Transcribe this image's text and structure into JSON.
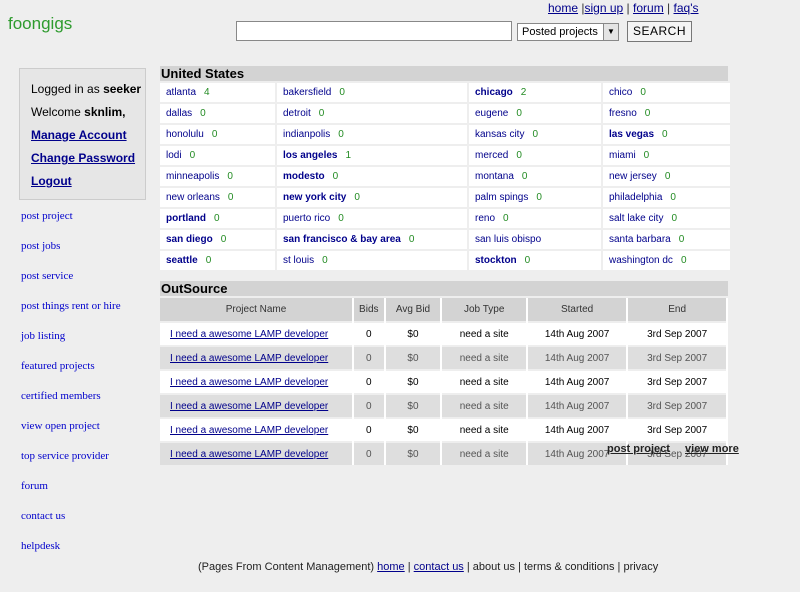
{
  "brand": "foongigs",
  "top_links": [
    {
      "label": "home"
    },
    {
      "label": "sign up"
    },
    {
      "label": "forum"
    },
    {
      "label": "faq's"
    }
  ],
  "search": {
    "value": "",
    "select_value": "Posted projects",
    "button_label": "SEARCH"
  },
  "user_panel": {
    "logged_in_text": "Logged in as ",
    "username": "seeker",
    "welcome_text": "Welcome ",
    "display_name": "sknlim,",
    "manage_account": "Manage Account",
    "change_password": "Change Password",
    "logout": "Logout"
  },
  "left_nav": [
    "post project",
    "post jobs",
    "post service",
    "post things rent or hire",
    "job listing",
    "featured projects",
    "certified members",
    "view open project",
    "top service provider",
    "forum",
    "contact us",
    "helpdesk"
  ],
  "us_section": {
    "title": "United States",
    "cities": [
      {
        "name": "atlanta",
        "count": "4",
        "bold": false
      },
      {
        "name": "bakersfield",
        "count": "0",
        "bold": false
      },
      {
        "name": "chicago",
        "count": "2",
        "bold": true
      },
      {
        "name": "chico",
        "count": "0",
        "bold": false
      },
      {
        "name": "dallas",
        "count": "0",
        "bold": false
      },
      {
        "name": "detroit",
        "count": "0",
        "bold": false
      },
      {
        "name": "eugene",
        "count": "0",
        "bold": false
      },
      {
        "name": "fresno",
        "count": "0",
        "bold": false
      },
      {
        "name": "honolulu",
        "count": "0",
        "bold": false
      },
      {
        "name": "indianpolis",
        "count": "0",
        "bold": false
      },
      {
        "name": "kansas city",
        "count": "0",
        "bold": false
      },
      {
        "name": "las vegas",
        "count": "0",
        "bold": true
      },
      {
        "name": "lodi",
        "count": "0",
        "bold": false
      },
      {
        "name": "los angeles",
        "count": "1",
        "bold": true
      },
      {
        "name": "merced",
        "count": "0",
        "bold": false
      },
      {
        "name": "miami",
        "count": "0",
        "bold": false
      },
      {
        "name": "minneapolis",
        "count": "0",
        "bold": false
      },
      {
        "name": "modesto",
        "count": "0",
        "bold": true
      },
      {
        "name": "montana",
        "count": "0",
        "bold": false
      },
      {
        "name": "new jersey",
        "count": "0",
        "bold": false
      },
      {
        "name": "new orleans",
        "count": "0",
        "bold": false
      },
      {
        "name": "new york city",
        "count": "0",
        "bold": true
      },
      {
        "name": "palm spings",
        "count": "0",
        "bold": false
      },
      {
        "name": "philadelphia",
        "count": "0",
        "bold": false
      },
      {
        "name": "portland",
        "count": "0",
        "bold": true
      },
      {
        "name": "puerto rico",
        "count": "0",
        "bold": false
      },
      {
        "name": "reno",
        "count": "0",
        "bold": false
      },
      {
        "name": "salt lake city",
        "count": "0",
        "bold": false
      },
      {
        "name": "san diego",
        "count": "0",
        "bold": true
      },
      {
        "name": "san francisco & bay area",
        "count": "0",
        "bold": true
      },
      {
        "name": "san luis obispo",
        "count": "",
        "bold": false
      },
      {
        "name": "santa barbara",
        "count": "0",
        "bold": false
      },
      {
        "name": "seattle",
        "count": "0",
        "bold": true
      },
      {
        "name": "st louis",
        "count": "0",
        "bold": false
      },
      {
        "name": "stockton",
        "count": "0",
        "bold": true
      },
      {
        "name": "washington dc",
        "count": "0",
        "bold": false
      }
    ]
  },
  "outsource": {
    "title": "OutSource",
    "columns": [
      "Project Name",
      "Bids",
      "Avg Bid",
      "Job Type",
      "Started",
      "End"
    ],
    "rows": [
      {
        "name": "I need a awesome LAMP developer",
        "bids": "0",
        "avg": "$0",
        "type": "need a site",
        "started": "14th Aug 2007",
        "end": "3rd Sep 2007"
      },
      {
        "name": "I need a awesome LAMP developer",
        "bids": "0",
        "avg": "$0",
        "type": "need a site",
        "started": "14th Aug 2007",
        "end": "3rd Sep 2007"
      },
      {
        "name": "I need a awesome LAMP developer",
        "bids": "0",
        "avg": "$0",
        "type": "need a site",
        "started": "14th Aug 2007",
        "end": "3rd Sep 2007"
      },
      {
        "name": "I need a awesome LAMP developer",
        "bids": "0",
        "avg": "$0",
        "type": "need a site",
        "started": "14th Aug 2007",
        "end": "3rd Sep 2007"
      },
      {
        "name": "I need a awesome LAMP developer",
        "bids": "0",
        "avg": "$0",
        "type": "need a site",
        "started": "14th Aug 2007",
        "end": "3rd Sep 2007"
      },
      {
        "name": "I need a awesome LAMP developer",
        "bids": "0",
        "avg": "$0",
        "type": "need a site",
        "started": "14th Aug 2007",
        "end": "3rd Sep 2007"
      }
    ],
    "post_project": "post project",
    "view_more": "view more"
  },
  "footer": {
    "prefix": "(Pages From Content Management)",
    "home": "home",
    "contact_us": "contact us",
    "about_us": "about us",
    "terms": "terms & conditions",
    "privacy": "privacy"
  }
}
